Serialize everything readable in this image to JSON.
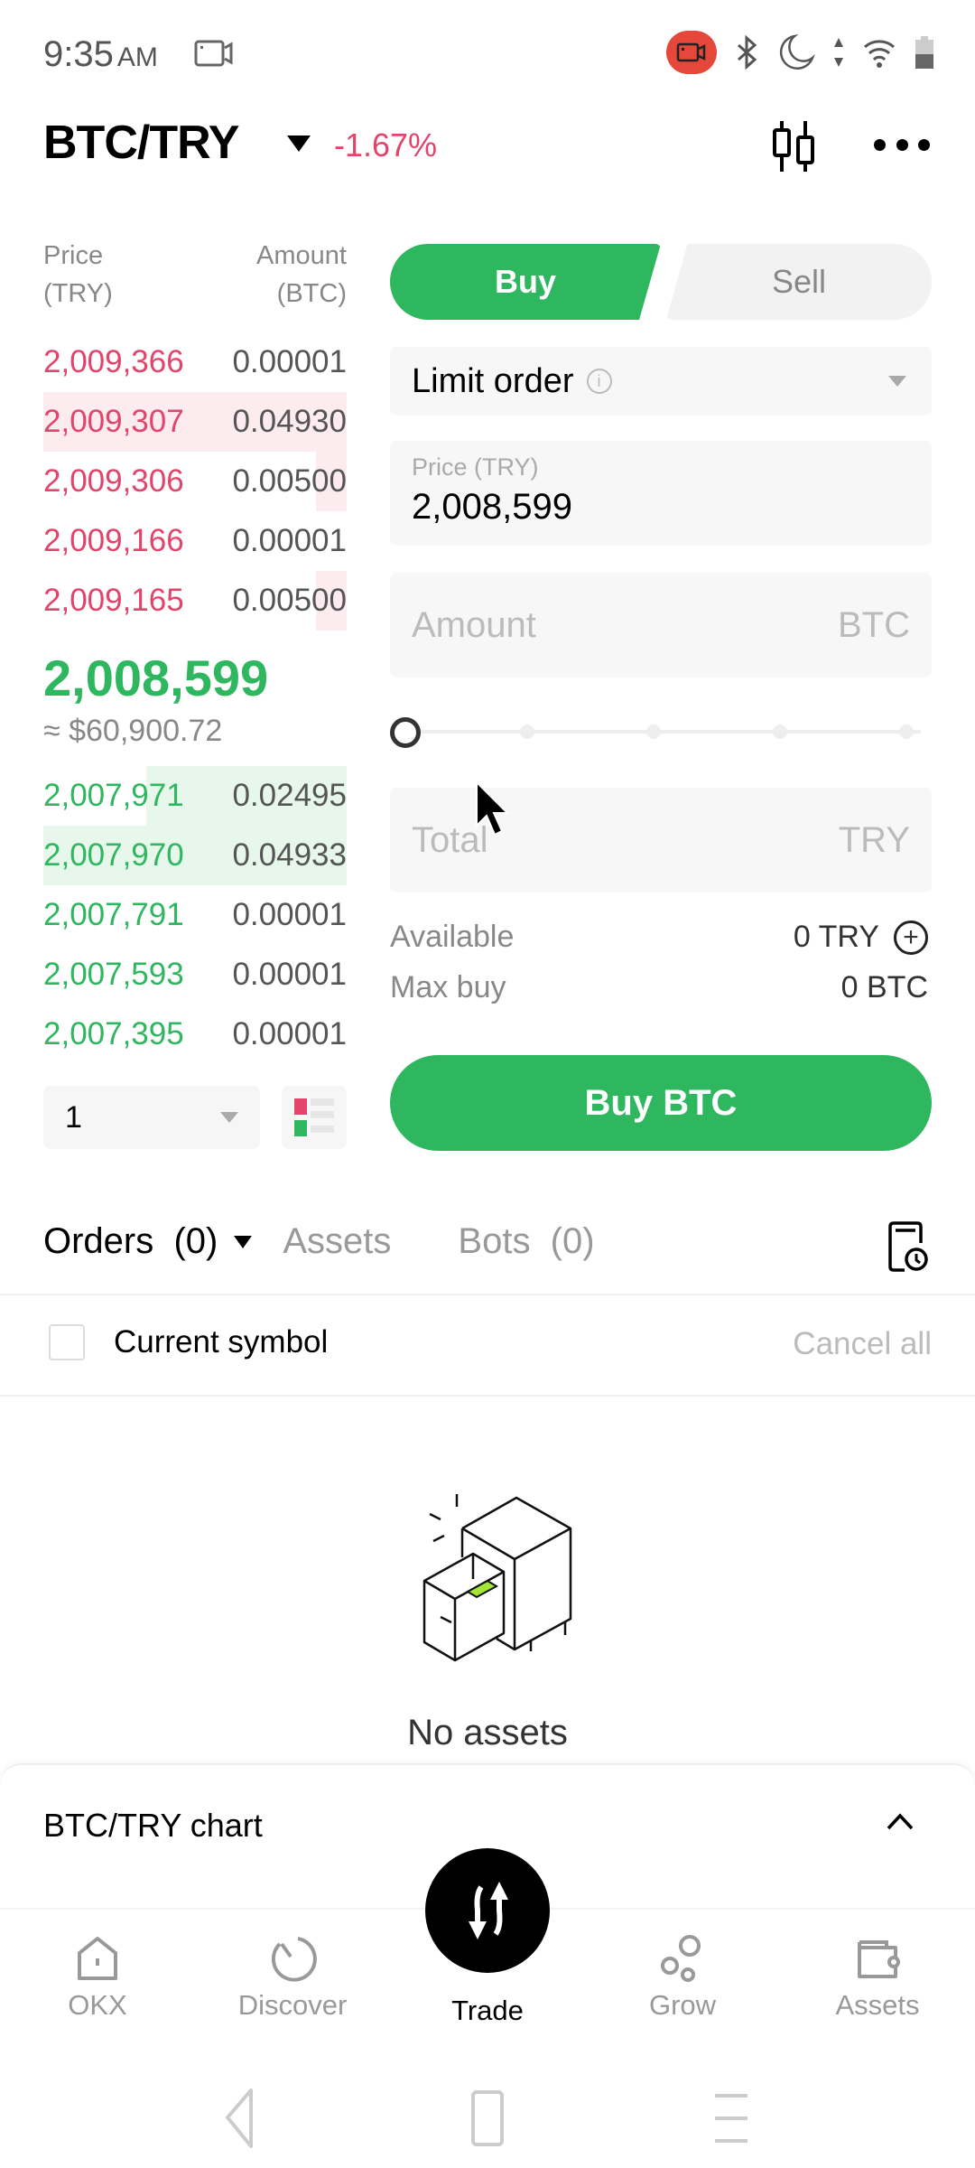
{
  "status_bar": {
    "time": "9:35",
    "ampm": "AM",
    "icons": [
      "screen-record-icon",
      "recording-pill-icon",
      "bluetooth-icon",
      "do-not-disturb-icon",
      "data-arrows-icon",
      "wifi-icon",
      "battery-icon"
    ]
  },
  "header": {
    "pair": "BTC/TRY",
    "change": "-1.67%",
    "colors": {
      "down": "#e2446b",
      "up": "#2fb760"
    }
  },
  "order_book": {
    "price_header": [
      "Price",
      "(TRY)"
    ],
    "amount_header": [
      "Amount",
      "(BTC)"
    ],
    "asks": [
      {
        "price": "2,009,366",
        "amount": "0.00001",
        "depth": 0.0
      },
      {
        "price": "2,009,307",
        "amount": "0.04930",
        "depth": 1.0
      },
      {
        "price": "2,009,306",
        "amount": "0.00500",
        "depth": 0.1
      },
      {
        "price": "2,009,166",
        "amount": "0.00001",
        "depth": 0.0
      },
      {
        "price": "2,009,165",
        "amount": "0.00500",
        "depth": 0.1
      }
    ],
    "last_price": "2,008,599",
    "last_price_usd": "≈ $60,900.72",
    "bids": [
      {
        "price": "2,007,971",
        "amount": "0.02495",
        "depth": 0.66
      },
      {
        "price": "2,007,970",
        "amount": "0.04933",
        "depth": 1.0
      },
      {
        "price": "2,007,791",
        "amount": "0.00001",
        "depth": 0.0
      },
      {
        "price": "2,007,593",
        "amount": "0.00001",
        "depth": 0.0
      },
      {
        "price": "2,007,395",
        "amount": "0.00001",
        "depth": 0.0
      }
    ],
    "precision": "1"
  },
  "trade_form": {
    "buy_label": "Buy",
    "sell_label": "Sell",
    "order_type": "Limit order",
    "price_label": "Price (TRY)",
    "price_value": "2,008,599",
    "amount_placeholder": "Amount",
    "amount_unit": "BTC",
    "slider_percent": 0,
    "total_placeholder": "Total",
    "total_unit": "TRY",
    "available_label": "Available",
    "available_value": "0 TRY",
    "max_buy_label": "Max buy",
    "max_buy_value": "0 BTC",
    "submit_label": "Buy BTC"
  },
  "orders": {
    "tab_orders": "Orders  (0)",
    "tab_assets": "Assets",
    "tab_bots": "Bots  (0)",
    "current_symbol_label": "Current symbol",
    "cancel_all_label": "Cancel all",
    "empty_text": "No assets"
  },
  "chart_bar": {
    "title": "BTC/TRY chart"
  },
  "bottom_nav": [
    {
      "label": "OKX",
      "icon": "home-icon"
    },
    {
      "label": "Discover",
      "icon": "discover-icon"
    },
    {
      "label": "Trade",
      "icon": "trade-icon",
      "active": true
    },
    {
      "label": "Grow",
      "icon": "grow-icon"
    },
    {
      "label": "Assets",
      "icon": "wallet-icon"
    }
  ]
}
